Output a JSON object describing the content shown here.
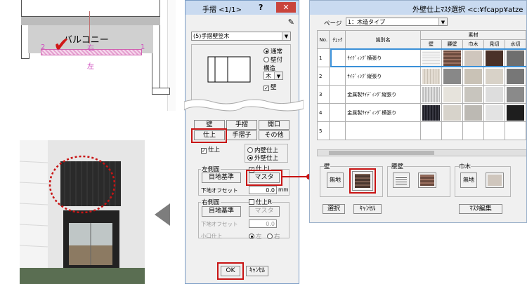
{
  "plan": {
    "balcony_label": "バルコニー",
    "marker_2": "2",
    "marker_1": "1",
    "marker_right": "右",
    "marker_left": "左"
  },
  "dialog": {
    "title": "手摺 <1/1>",
    "help": "?",
    "close": "✕",
    "type_select": "(5)手摺壁笠木",
    "radio_normal": "通常",
    "radio_wallattached": "壁付",
    "structure_label": "構造",
    "structure_value": "木",
    "wall_check": "壁",
    "tabs": [
      "壁",
      "手摺",
      "開口",
      "仕上",
      "手摺子",
      "その他"
    ],
    "finish_check": "仕上",
    "inner_wall_finish": "内壁仕上",
    "outer_wall_finish": "外壁仕上",
    "left_side_label": "左側面",
    "left_finish_check": "仕上L",
    "base_std_left": "目地基準",
    "master_left": "マスタ",
    "offset_label_left": "下地オフセット",
    "offset_value_left": "0.0",
    "unit_mm": "mm",
    "right_side_label": "右側面",
    "right_finish_check": "仕上R",
    "base_std_right": "目地基準",
    "master_right": "マスタ",
    "offset_label_right": "下地オフセット",
    "offset_value_right": "0.0",
    "small_finish": "小口仕上",
    "small_left": "左",
    "small_right": "右",
    "ok": "OK",
    "cancel": "ｷｬﾝｾﾙ"
  },
  "master": {
    "title": "外壁仕上ﾏｽﾀ選択 <c:¥fcapp¥atze",
    "page_label": "ページ",
    "page_value": "1：木造タイプ",
    "col_no": "No.",
    "col_check": "ﾁｪｯｸ",
    "col_name": "識別名",
    "col_material": "素材",
    "sub_cols": [
      "壁",
      "腰壁",
      "巾木",
      "見切",
      "水切"
    ],
    "rows": [
      {
        "no": "1",
        "name": "ｻｲﾃﾞｨﾝｸﾞ横張り"
      },
      {
        "no": "2",
        "name": "ｻｲﾃﾞｨﾝｸﾞ縦張り"
      },
      {
        "no": "3",
        "name": "金属製ｻｲﾃﾞｨﾝｸﾞ縦張り"
      },
      {
        "no": "4",
        "name": "金属製ｻｲﾃﾞｨﾝｸﾞ横張り"
      },
      {
        "no": "5",
        "name": ""
      }
    ],
    "group_wall": "壁",
    "group_waist": "腰壁",
    "group_baseboard": "巾木",
    "none_label": "無地",
    "select_btn": "選択",
    "cancel_btn": "ｷｬﾝｾﾙ",
    "edit_btn": "ﾏｽﾀ編集"
  },
  "colors": {
    "highlight_red": "#c81414",
    "selected_row": "#3a90d8",
    "accent_pink": "#d050c0"
  }
}
